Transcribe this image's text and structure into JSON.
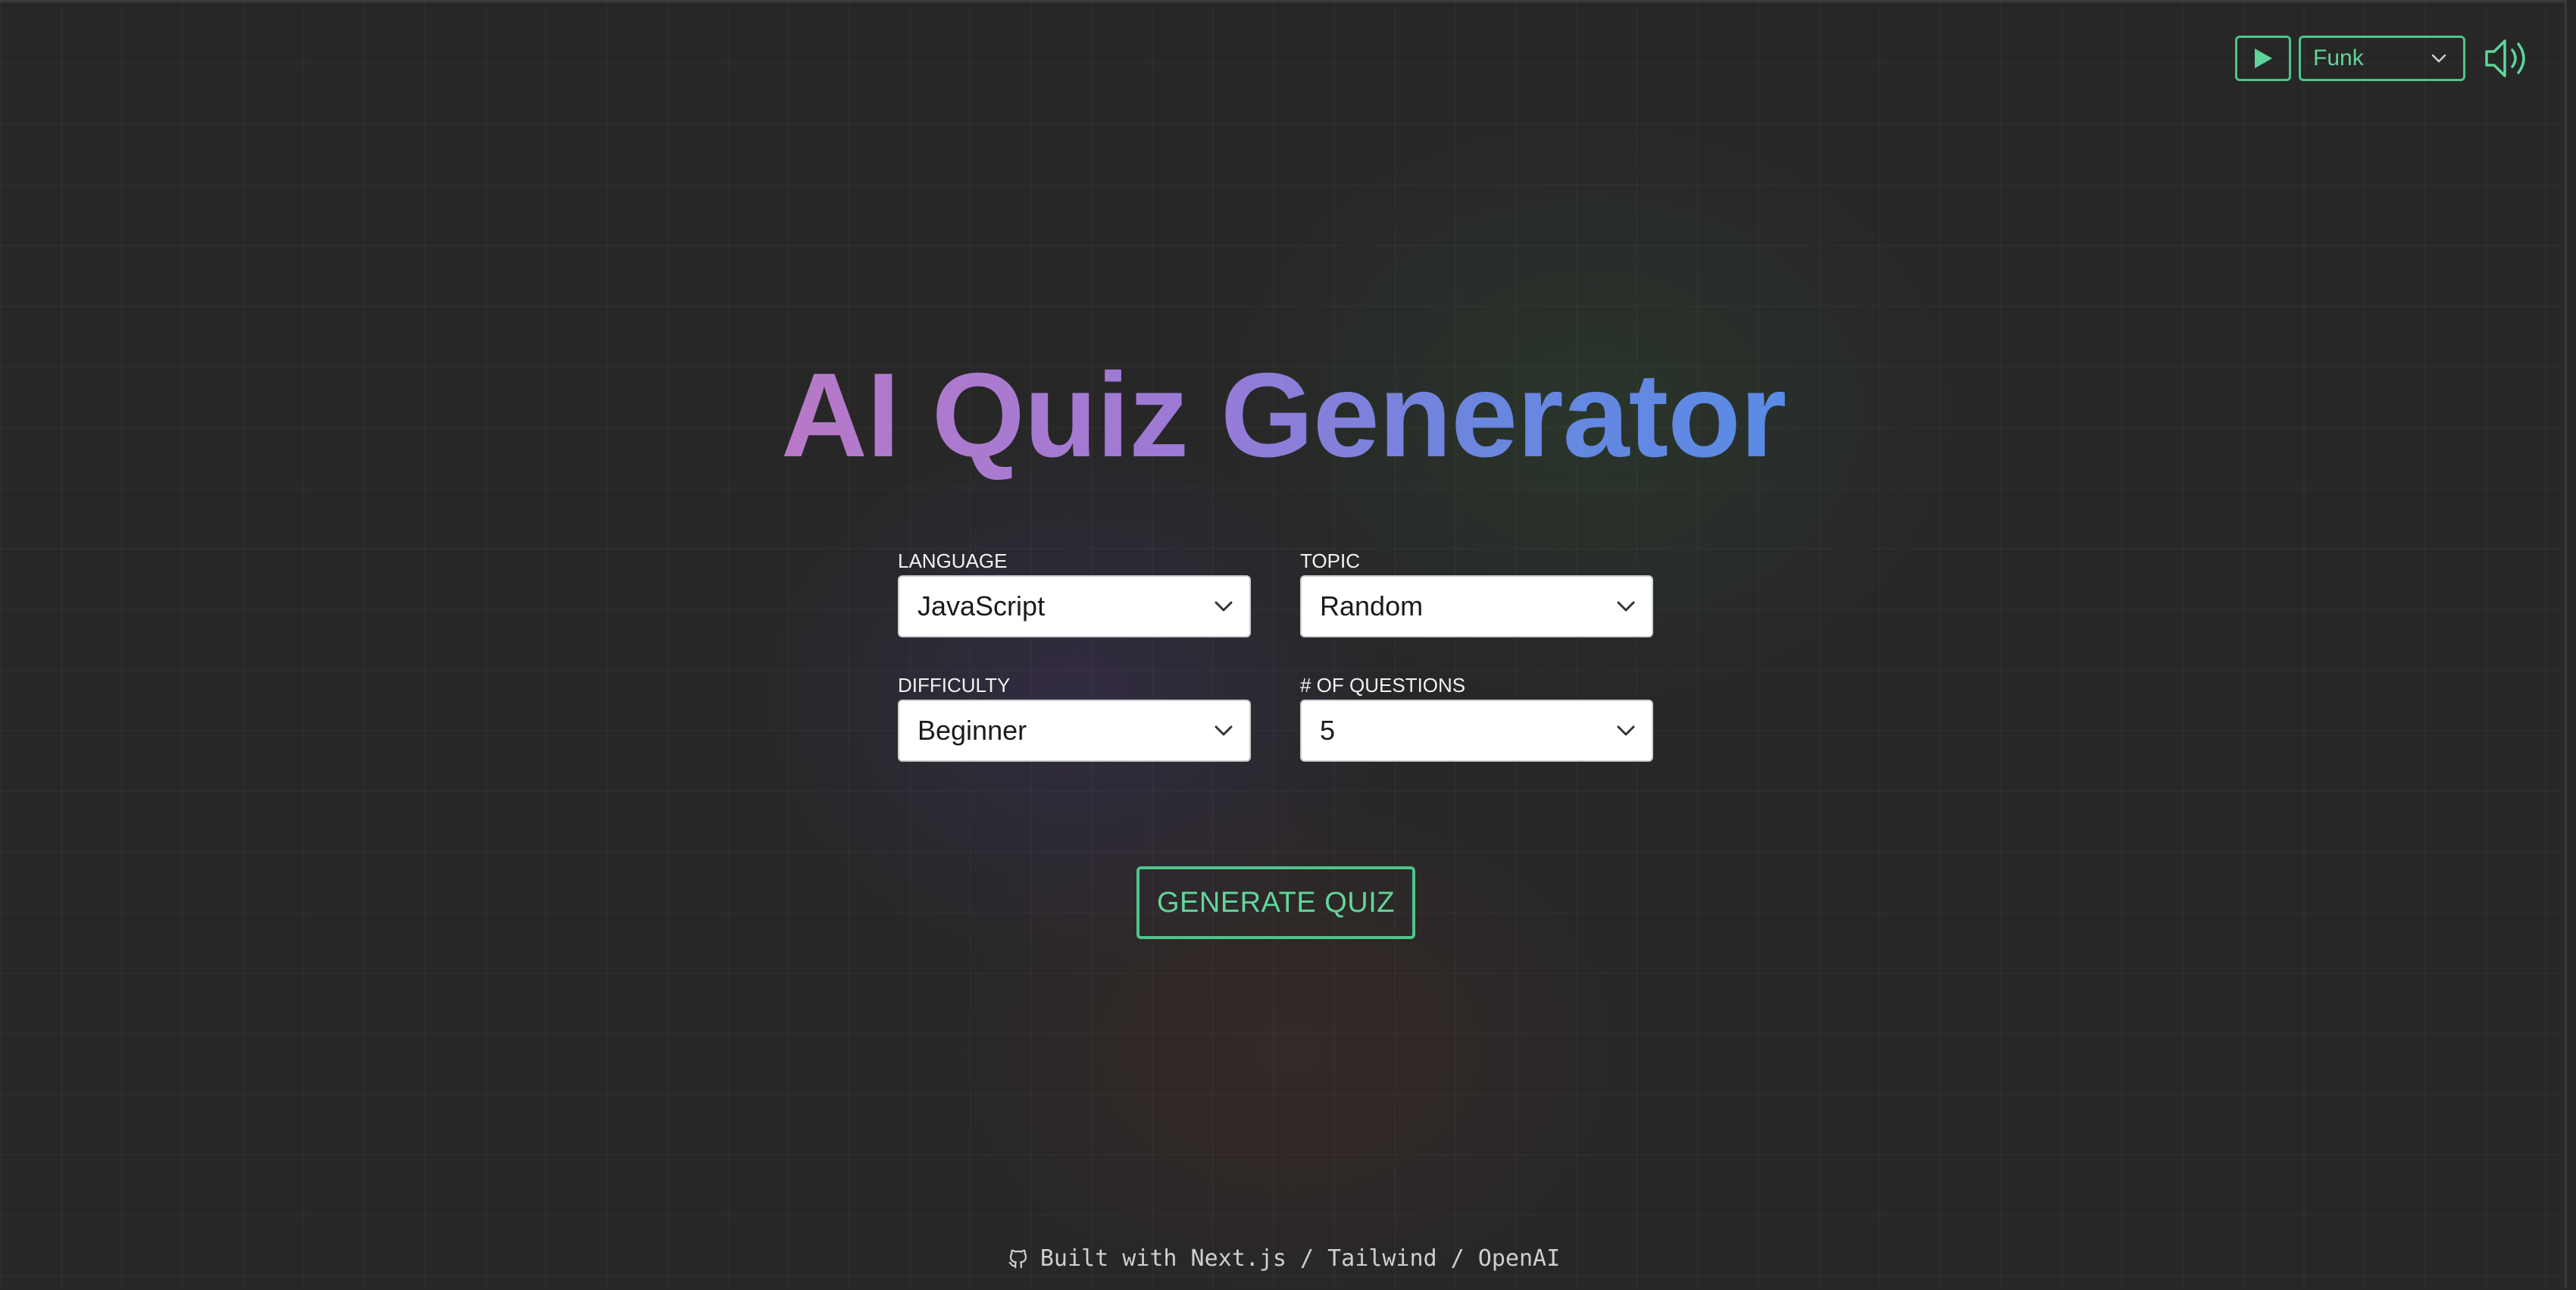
{
  "colors": {
    "accent": "#4fc48a",
    "title_gradient_start": "#b879c7",
    "title_gradient_end": "#5a8be6",
    "background": "#272727"
  },
  "audio": {
    "play_icon": "play-icon",
    "track_selected": "Funk",
    "volume_icon": "volume-icon"
  },
  "title": "AI Quiz Generator",
  "form": {
    "language": {
      "label": "LANGUAGE",
      "value": "JavaScript"
    },
    "topic": {
      "label": "TOPIC",
      "value": "Random"
    },
    "difficulty": {
      "label": "DIFFICULTY",
      "value": "Beginner"
    },
    "questions": {
      "label": "# OF QUESTIONS",
      "value": "5"
    }
  },
  "generate_button": "GENERATE QUIZ",
  "footer": {
    "icon": "github-icon",
    "text": "Built with Next.js / Tailwind / OpenAI"
  }
}
